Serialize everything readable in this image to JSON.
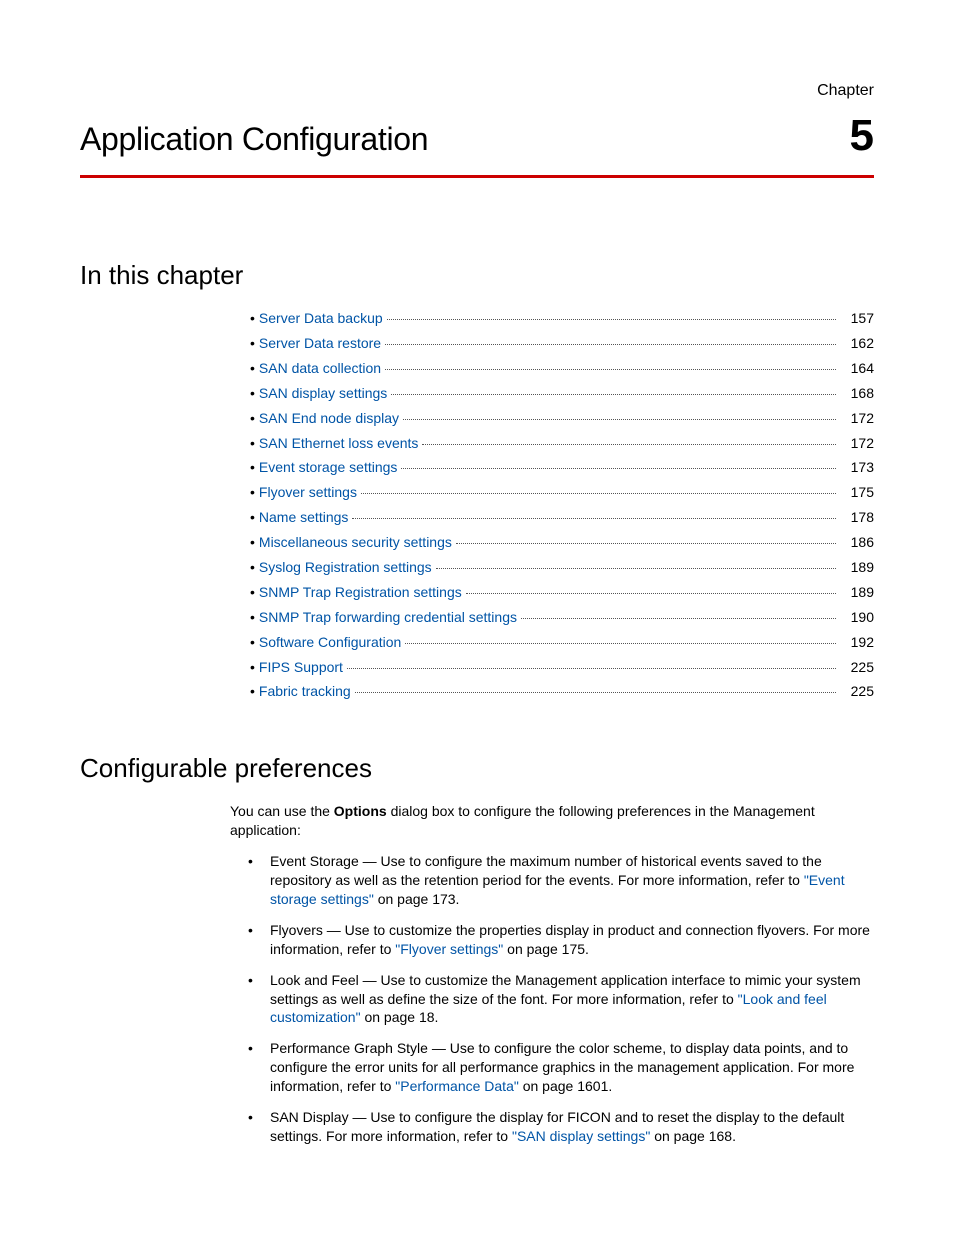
{
  "chapter_label": "Chapter",
  "chapter_number": "5",
  "chapter_title": "Application Configuration",
  "toc_heading": "In this chapter",
  "toc": [
    {
      "label": "Server Data backup",
      "page": "157"
    },
    {
      "label": "Server Data restore",
      "page": "162"
    },
    {
      "label": "SAN data collection",
      "page": "164"
    },
    {
      "label": "SAN display settings",
      "page": "168"
    },
    {
      "label": "SAN End node display",
      "page": "172"
    },
    {
      "label": "SAN Ethernet loss events",
      "page": "172"
    },
    {
      "label": "Event storage settings",
      "page": "173"
    },
    {
      "label": "Flyover settings",
      "page": "175"
    },
    {
      "label": "Name settings",
      "page": "178"
    },
    {
      "label": "Miscellaneous security settings",
      "page": "186"
    },
    {
      "label": "Syslog Registration settings",
      "page": "189"
    },
    {
      "label": "SNMP Trap Registration settings",
      "page": "189"
    },
    {
      "label": "SNMP Trap forwarding credential settings",
      "page": "190"
    },
    {
      "label": "Software Configuration",
      "page": "192"
    },
    {
      "label": "FIPS Support",
      "page": "225"
    },
    {
      "label": "Fabric tracking",
      "page": "225"
    }
  ],
  "section_heading": "Configurable preferences",
  "intro": {
    "a": "You can use the ",
    "bold": "Options",
    "b": " dialog box to configure the following preferences in the Management application:"
  },
  "prefs": [
    {
      "title": "Event Storage",
      "text_a": " — Use to configure the maximum number of historical events saved to the repository as well as the retention period for the events. For more information, refer to ",
      "link": "\"Event storage settings\"",
      "text_b": " on page 173."
    },
    {
      "title": "Flyovers",
      "text_a": " — Use to customize the properties display in product and connection flyovers. For more information, refer to ",
      "link": "\"Flyover settings\"",
      "text_b": " on page 175."
    },
    {
      "title": "Look and Feel",
      "text_a": " — Use to customize the Management application interface to mimic your system settings as well as define the size of the font. For more information, refer to ",
      "link": "\"Look and feel customization\"",
      "text_b": " on page 18."
    },
    {
      "title": "Performance Graph Style",
      "text_a": " — Use to configure the color scheme, to display data points, and to configure the error units for all performance graphics in the management application. For more information, refer to ",
      "link": "\"Performance Data\"",
      "text_b": " on page 1601."
    },
    {
      "title": "SAN Display",
      "text_a": " — Use to configure the display for FICON and to reset the display to the default settings. For more information, refer to ",
      "link": "\"SAN display settings\"",
      "text_b": " on page 168."
    }
  ]
}
